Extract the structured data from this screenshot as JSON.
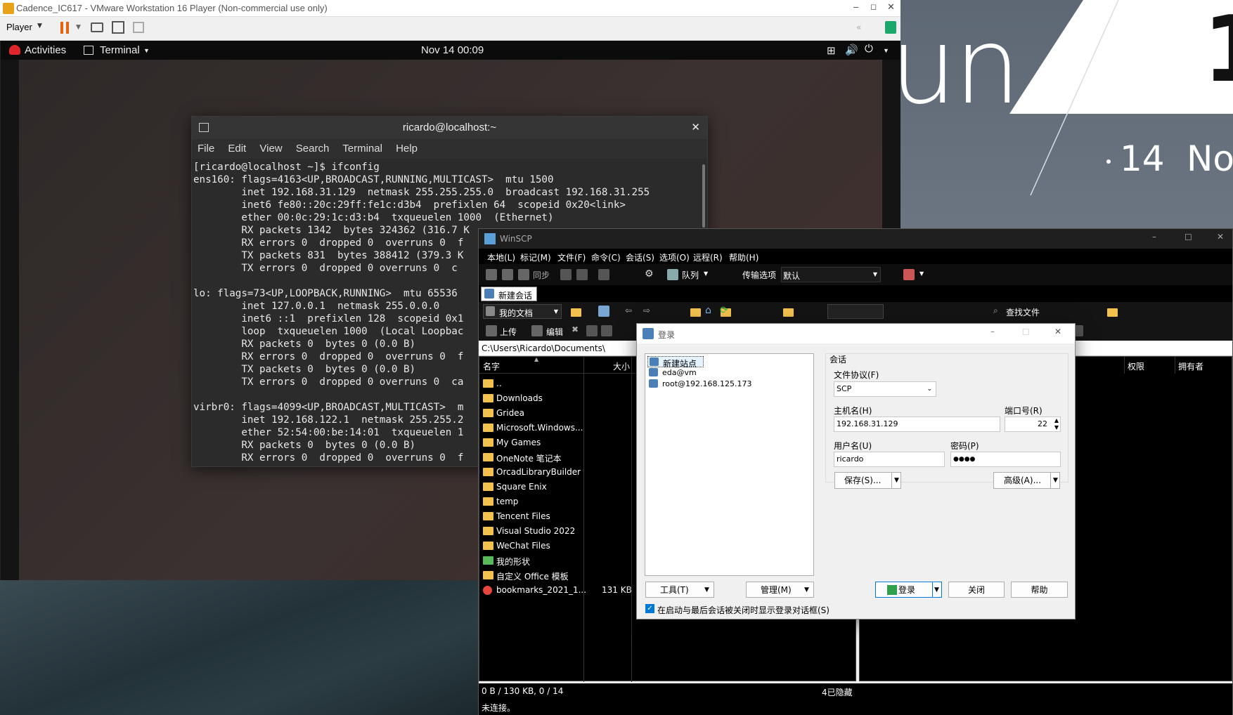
{
  "vm": {
    "title": "Cadence_IC617 - VMware Workstation 16 Player (Non-commercial use only)",
    "player_label": "Player"
  },
  "gnome": {
    "activities": "Activities",
    "app": "Terminal",
    "clock": "Nov 14  00:09"
  },
  "wallpaper": {
    "text1": "un",
    "text2": "1",
    "date_day": "14",
    "date_mon": "No"
  },
  "terminal": {
    "title": "ricardo@localhost:~",
    "menu": [
      "File",
      "Edit",
      "View",
      "Search",
      "Terminal",
      "Help"
    ],
    "lines": [
      "[ricardo@localhost ~]$ ifconfig",
      "ens160: flags=4163<UP,BROADCAST,RUNNING,MULTICAST>  mtu 1500",
      "        inet 192.168.31.129  netmask 255.255.255.0  broadcast 192.168.31.255",
      "        inet6 fe80::20c:29ff:fe1c:d3b4  prefixlen 64  scopeid 0x20<link>",
      "        ether 00:0c:29:1c:d3:b4  txqueuelen 1000  (Ethernet)",
      "        RX packets 1342  bytes 324362 (316.7 K",
      "        RX errors 0  dropped 0  overruns 0  f",
      "        TX packets 831  bytes 388412 (379.3 K",
      "        TX errors 0  dropped 0 overruns 0  c",
      "",
      "lo: flags=73<UP,LOOPBACK,RUNNING>  mtu 65536",
      "        inet 127.0.0.1  netmask 255.0.0.0",
      "        inet6 ::1  prefixlen 128  scopeid 0x1",
      "        loop  txqueuelen 1000  (Local Loopbac",
      "        RX packets 0  bytes 0 (0.0 B)",
      "        RX errors 0  dropped 0  overruns 0  f",
      "        TX packets 0  bytes 0 (0.0 B)",
      "        TX errors 0  dropped 0 overruns 0  ca",
      "",
      "virbr0: flags=4099<UP,BROADCAST,MULTICAST>  m",
      "        inet 192.168.122.1  netmask 255.255.2",
      "        ether 52:54:00:be:14:01  txqueuelen 1",
      "        RX packets 0  bytes 0 (0.0 B)",
      "        RX errors 0  dropped 0  overruns 0  f"
    ]
  },
  "winscp": {
    "title": "WinSCP",
    "menu": [
      "本地(L)",
      "标记(M)",
      "文件(F)",
      "命令(C)",
      "会话(S)",
      "选项(O)",
      "远程(R)",
      "帮助(H)"
    ],
    "sync": "同步",
    "queue": "队列",
    "transfer_label": "传输选项",
    "transfer_value": "默认",
    "tab": "新建会话",
    "local_dir_combo": "我的文档",
    "upload": "上传",
    "edit": "编辑",
    "find_files": "查找文件",
    "path": "C:\\Users\\Ricardo\\Documents\\",
    "col_name": "名字",
    "col_size": "大小",
    "col_perm": "权限",
    "col_owner": "拥有者",
    "files": [
      {
        "name": "..",
        "size": ""
      },
      {
        "name": "Downloads",
        "size": ""
      },
      {
        "name": "Gridea",
        "size": ""
      },
      {
        "name": "Microsoft.Windows...",
        "size": ""
      },
      {
        "name": "My Games",
        "size": ""
      },
      {
        "name": "OneNote 笔记本",
        "size": ""
      },
      {
        "name": "OrcadLibraryBuilder",
        "size": ""
      },
      {
        "name": "Square Enix",
        "size": ""
      },
      {
        "name": "temp",
        "size": ""
      },
      {
        "name": "Tencent Files",
        "size": ""
      },
      {
        "name": "Visual Studio 2022",
        "size": ""
      },
      {
        "name": "WeChat Files",
        "size": ""
      },
      {
        "name": "我的形状",
        "size": ""
      },
      {
        "name": "自定义 Office 模板",
        "size": ""
      },
      {
        "name": "bookmarks_2021_1...",
        "size": "131 KB"
      }
    ],
    "status_left": "0 B / 130 KB,  0 / 14",
    "status_hidden": "4已隐藏",
    "status_conn": "未连接。"
  },
  "login": {
    "title": "登录",
    "sites": [
      "新建站点",
      "eda@vm",
      "root@192.168.125.173"
    ],
    "group": "会话",
    "protocol_label": "文件协议(F)",
    "protocol": "SCP",
    "host_label": "主机名(H)",
    "host": "192.168.31.129",
    "port_label": "端口号(R)",
    "port": "22",
    "user_label": "用户名(U)",
    "user": "ricardo",
    "pass_label": "密码(P)",
    "pass": "●●●●",
    "save": "保存(S)...",
    "advanced": "高级(A)...",
    "tools": "工具(T)",
    "manage": "管理(M)",
    "login_btn": "登录",
    "close": "关闭",
    "help": "帮助",
    "checkbox": "在启动与最后会话被关闭时显示登录对话框(S)"
  }
}
